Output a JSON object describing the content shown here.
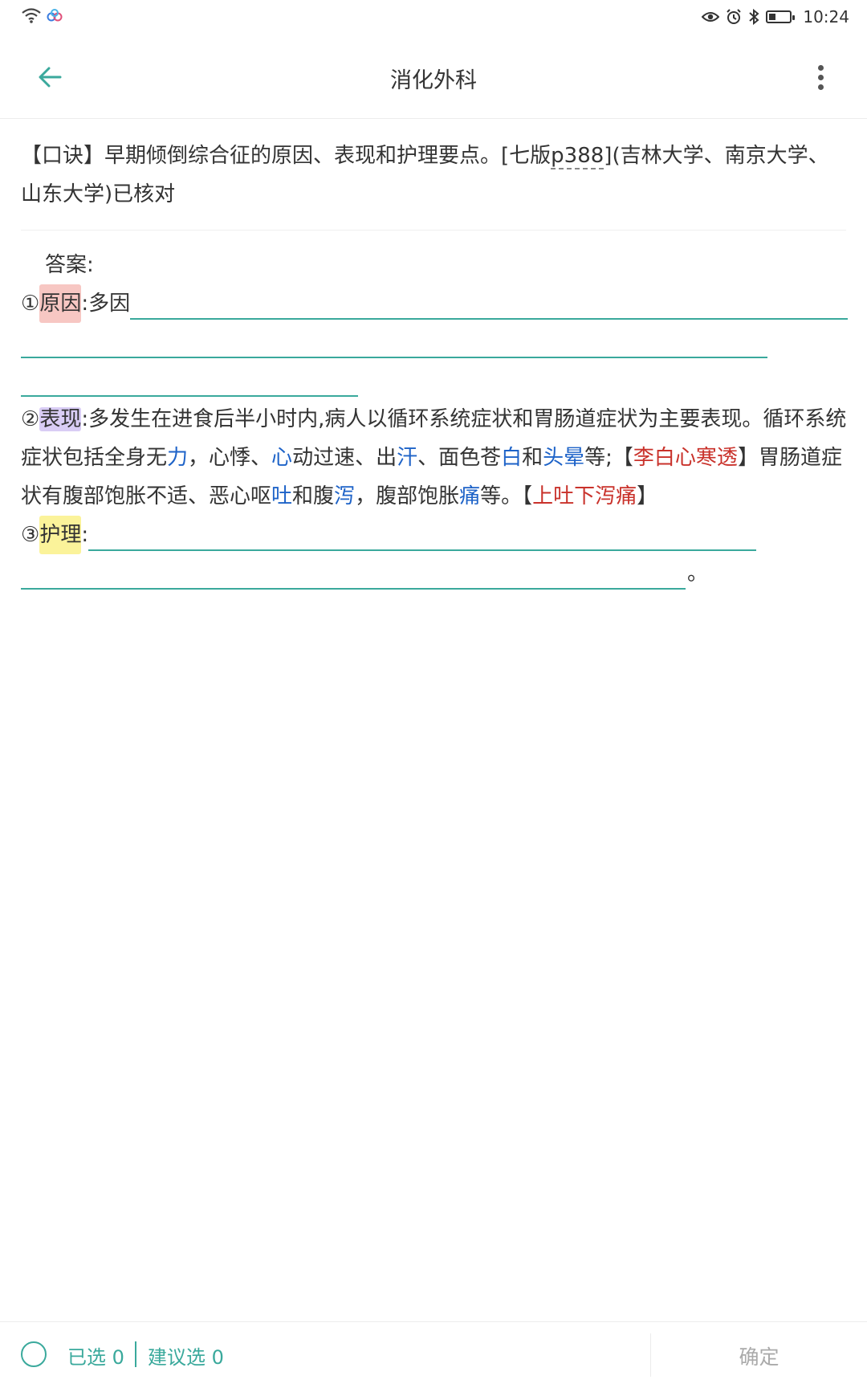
{
  "status_bar": {
    "time": "10:24",
    "battery_level": 0.35,
    "icons": [
      "wifi-icon",
      "cloud-link-icon",
      "eye-icon",
      "alarm-icon",
      "bluetooth-icon",
      "battery-icon"
    ]
  },
  "header": {
    "title": "消化外科"
  },
  "question": {
    "prefix": "【口诀】早期倾倒综合征的原因、表现和护理要点。[七版",
    "page_ref": "p388",
    "suffix": "](吉林大学、南京大学、山东大学)已核对"
  },
  "answer": {
    "label": "答案:",
    "item1": {
      "num": "①",
      "key": "原因",
      "text": ":多因"
    },
    "item2": {
      "num": "②",
      "key": "表现",
      "t1": ":多发生在进食后半小时内,病人以循环系统症状和胃肠道症状为主要表现。循环系统症状包括全身无",
      "h1": "力",
      "t2": "，心悸、",
      "h2": "心",
      "t3": "动过速、出",
      "h3": "汗",
      "t4": "、面色苍",
      "h4": "白",
      "t5": "和",
      "h5": "头晕",
      "t6": "等;【",
      "m1": "李白心寒透",
      "t7": "】胃肠道症状有腹部饱胀不适、恶心呕",
      "h6": "吐",
      "t8": "和腹",
      "h7": "泻",
      "t9": "，腹部饱胀",
      "h8": "痛",
      "t10": "等。【",
      "m2": "上吐下泻痛",
      "t11": "】"
    },
    "item3": {
      "num": "③",
      "key": "护理",
      "colon": ":",
      "end": "。"
    }
  },
  "bottom_bar": {
    "selected": "已选 0",
    "suggested": "建议选 0",
    "confirm": "确定"
  },
  "colors": {
    "accent": "#3aa99c",
    "blue_hint": "#1e63c8",
    "red_mnemonic": "#c9322b",
    "highlight_red": "#f7c7c3",
    "highlight_purple": "#d9cdf5",
    "highlight_yellow": "#fbf39a"
  }
}
